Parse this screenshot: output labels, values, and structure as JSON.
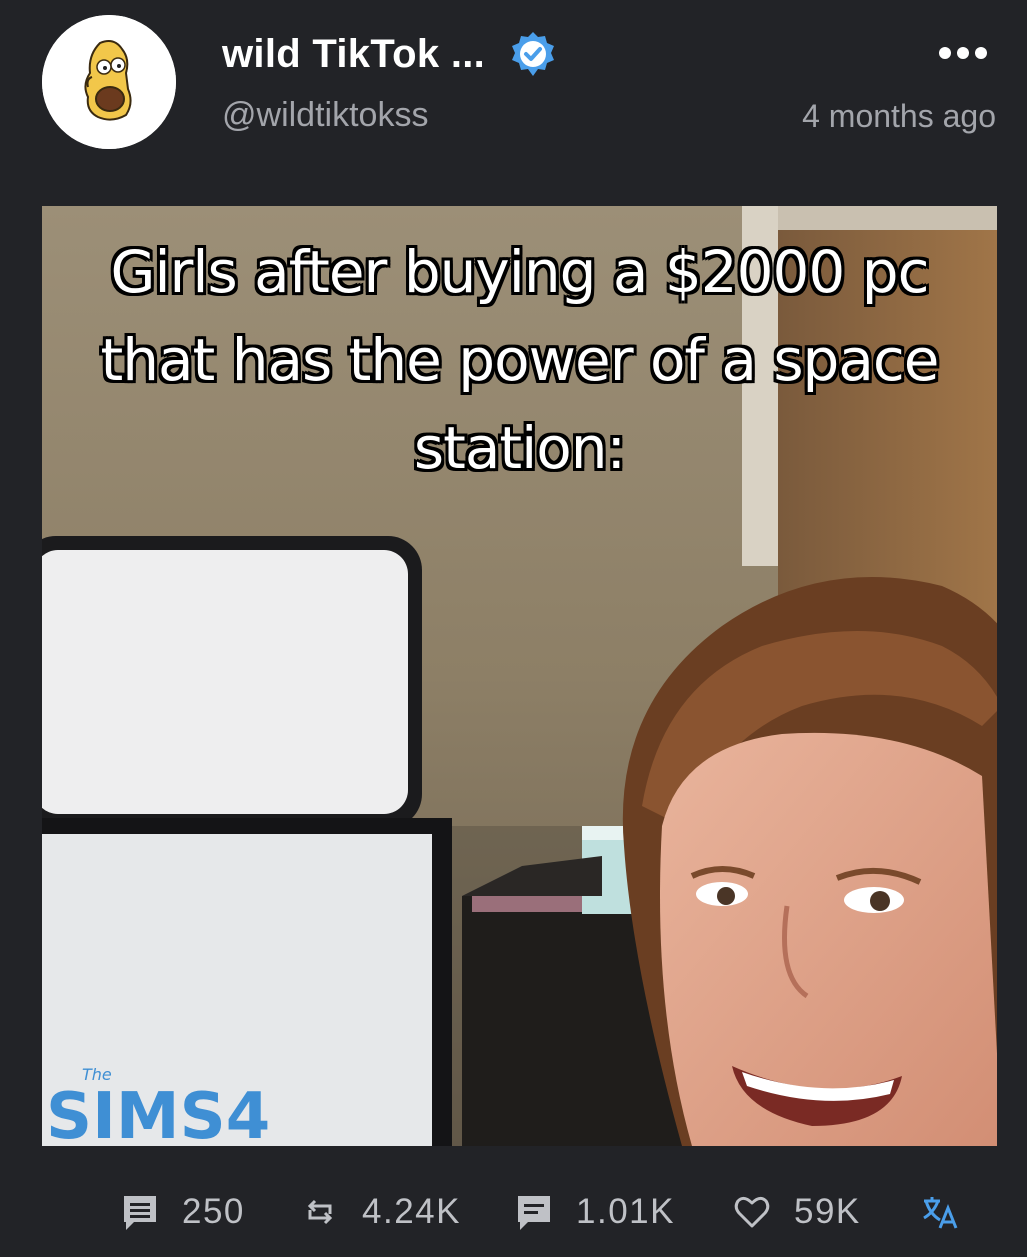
{
  "post": {
    "author": {
      "display_name": "wild TikTok ...",
      "handle": "@wildtiktokss",
      "verified": true
    },
    "timestamp": "4 months ago",
    "media": {
      "caption": "Girls after buying a $2000 pc that has the power of a space station:",
      "monitor_text": "SIMS4",
      "monitor_small": "The"
    },
    "actions": {
      "comments": "250",
      "reposts": "4.24K",
      "quotes": "1.01K",
      "likes": "59K"
    }
  },
  "colors": {
    "background": "#222327",
    "accent": "#4a9eea",
    "secondary_text": "#a3a5ab"
  },
  "icons": [
    "verified-badge-icon",
    "more-options-icon",
    "comment-icon",
    "repost-icon",
    "quote-icon",
    "heart-icon",
    "translate-icon"
  ]
}
